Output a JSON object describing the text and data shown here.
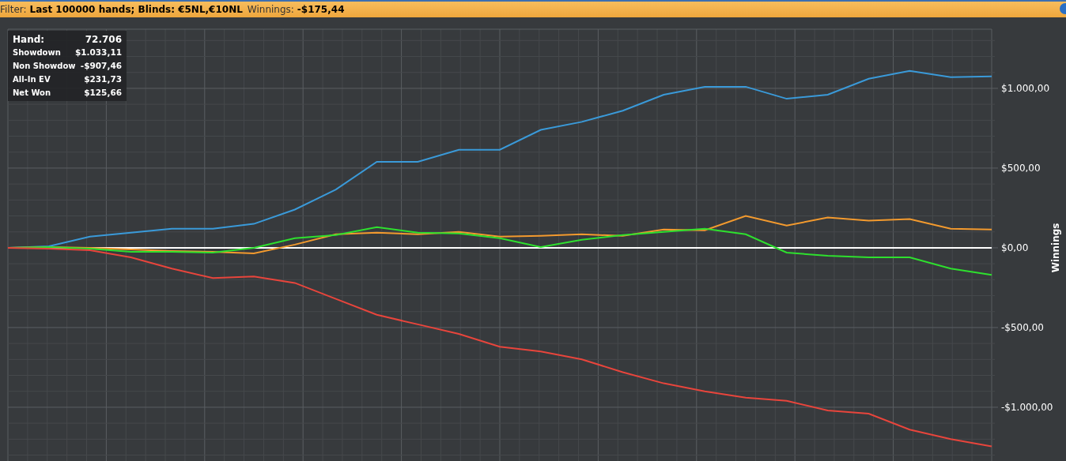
{
  "filter_bar": {
    "label": "Filter:",
    "value": "Last 100000 hands; Blinds: €5NL,€10NL",
    "winnings_label": "Winnings:",
    "winnings_value": "-$175,44"
  },
  "stats": [
    {
      "label": "Hand:",
      "value": "72.706"
    },
    {
      "label": "Showdown",
      "value": "$1.033,11"
    },
    {
      "label": "Non Showdow",
      "value": "-$907,46"
    },
    {
      "label": "All-In EV",
      "value": "$231,73"
    },
    {
      "label": "Net Won",
      "value": "$125,66"
    }
  ],
  "chart": {
    "chart_data": {
      "type": "line",
      "ylabel": "Winnings",
      "grid": true,
      "ylim": [
        -1337,
        1371
      ],
      "yticks": [
        {
          "value": 1000,
          "label": "$1.000,00"
        },
        {
          "value": 500,
          "label": "$500,00"
        },
        {
          "value": 0,
          "label": "$0,00"
        },
        {
          "value": -500,
          "label": "-$500,00"
        },
        {
          "value": -1000,
          "label": "-$1.000,00"
        }
      ],
      "series": [
        {
          "color": "#3a9ad9",
          "values": [
            0,
            10,
            70,
            95,
            120,
            120,
            150,
            240,
            365,
            540,
            540,
            615,
            615,
            740,
            790,
            860,
            960,
            1010,
            1010,
            935,
            960,
            1060,
            1110,
            1070,
            1075
          ]
        },
        {
          "color": "#f39a2e",
          "values": [
            0,
            5,
            0,
            -10,
            -20,
            -25,
            -35,
            20,
            85,
            95,
            85,
            100,
            70,
            75,
            85,
            75,
            115,
            110,
            200,
            140,
            190,
            170,
            180,
            120,
            115
          ]
        },
        {
          "color": "#2ee02e",
          "values": [
            0,
            5,
            -5,
            -25,
            -25,
            -30,
            0,
            60,
            80,
            130,
            95,
            90,
            60,
            5,
            50,
            80,
            100,
            120,
            85,
            -30,
            -50,
            -60,
            -60,
            -130,
            -170
          ]
        },
        {
          "color": "#e8453c",
          "values": [
            0,
            -5,
            -15,
            -60,
            -130,
            -190,
            -180,
            -220,
            -320,
            -420,
            -480,
            -540,
            -620,
            -650,
            -700,
            -780,
            -850,
            -900,
            -940,
            -960,
            -1020,
            -1040,
            -1140,
            -1200,
            -1245
          ]
        }
      ]
    }
  }
}
